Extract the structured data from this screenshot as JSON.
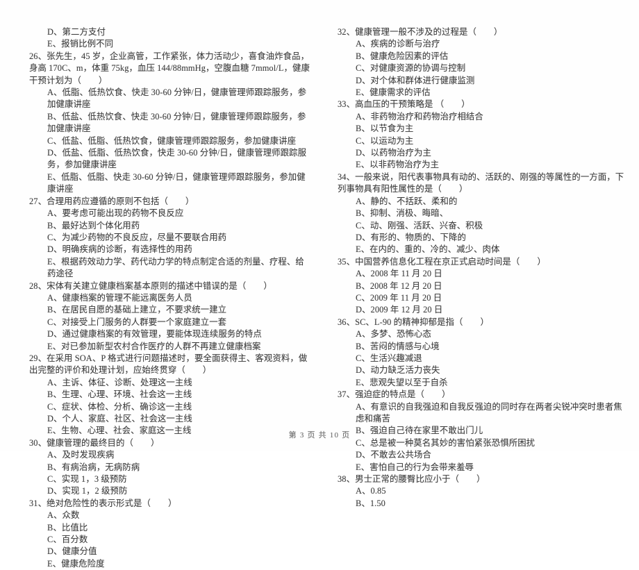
{
  "document": {
    "footer": "第 3 页 共 10 页",
    "page_number": "3",
    "total_pages": "10"
  },
  "left_column": {
    "orphan_options": [
      "D、第二方支付",
      "E、报销比例不同"
    ],
    "questions": [
      {
        "stem": "26、张先生，45 岁，企业高管，工作紧张，体力活动少，喜食油炸食品，身高 170C、m，体重 75kg，血压 144/88mmHg，空腹血糖 7mmol/L，健康干预计划为（　　）",
        "options": [
          "A、低脂、低热饮食、快走 30-60 分钟/日，健康管理师跟踪服务，参加健康讲座",
          "B、低盐、低热饮食、快走 30-60 分钟/日，健康管理师跟踪服务，参加健康讲座",
          "C、低盐、低脂、低热饮食，健康管理师跟踪服务，参加健康讲座",
          "D、低盐、低脂、低热饮食，快走 30-60 分钟/日，健康管理师跟踪服务，参加健康讲座",
          "E、低脂、低脂、快走 30-60 分钟/日，健康管理师跟踪服务，参加健康讲座"
        ]
      },
      {
        "stem": "27、合理用药应遵循的原则不包括（　　）",
        "options": [
          "A、要考虑可能出现的药物不良反应",
          "B、最好达到个体化用药",
          "C、为减少药物的不良反应，尽量不要联合用药",
          "D、明确疾病的诊断，有选择性的用药",
          "E、根据药效动力学、药代动力学的特点制定合适的剂量、疗程、给药途径"
        ]
      },
      {
        "stem": "28、宋体有关建立健康档案基本原则的描述中错误的是（　　）",
        "options": [
          "A、健康档案的管理不能远离医务人员",
          "B、在居民自愿的基础上建立，不要求统一建立",
          "C、对接受上门服务的人群要一个家庭建立一套",
          "D、通过健康档案的有效管理，要能体现连续服务的特点",
          "E、对已参加新型农村合作医疗的人群不再建立健康档案"
        ]
      },
      {
        "stem": "29、在采用 SOA、P 格式进行问题描述时，要全面获得主、客观资料，做出完整的评价和处理计划，应始终贯穿（　　）",
        "options": [
          "A、主诉、体征、诊断、处理这一主线",
          "B、生理、心理、环境、社会这一主线",
          "C、症状、体检、分析、确诊这一主线",
          "D、个人、家庭、社区、社会这一主线",
          "E、生物、心理、社会、家庭这一主线"
        ]
      },
      {
        "stem": "30、健康管理的最终目的（　　）",
        "options": [
          "A、及时发现疾病",
          "B、有病治病，无病防病",
          "C、实现 1，3 级预防",
          "D、实现 1，2 级预防"
        ]
      },
      {
        "stem": "31、绝对危险性的表示形式是（　　）",
        "options": [
          "A、众数",
          "B、比值比",
          "C、百分数",
          "D、健康分值",
          "E、健康危险度"
        ]
      }
    ]
  },
  "right_column": {
    "questions": [
      {
        "stem": "32、健康管理一般不涉及的过程是（　　）",
        "options": [
          "A、疾病的诊断与治疗",
          "B、健康危险因素的评估",
          "C、对健康资源的协调与控制",
          "D、对个体和群体进行健康监测",
          "E、健康需求的评估"
        ]
      },
      {
        "stem": "33、高血压的干预策略是 （　　）",
        "options": [
          "A、非药物治疗和药物治疗相结合",
          "B、以节食为主",
          "C、以运动为主",
          "D、以药物治疗为主",
          "E、以非药物治疗为主"
        ]
      },
      {
        "stem": "34、一般来说，阳代表事物具有动的、活跃的、刚强的等属性的一方面，下列事物具有阳性属性的是（　　）",
        "options": [
          "A、静的、不括跃、柔和的",
          "B、抑制、消极、晦暗、",
          "C、动、刚强、活跃、兴奋、积极",
          "D、有形的、物质的、下降的",
          "E、在内的、重的、冷的、减少、肉体"
        ]
      },
      {
        "stem": "35、中国营养信息化工程在京正式启动时间是（　　）",
        "options": [
          "A、2008 年 11 月 20 日",
          "B、2008 年 12 月 20 日",
          "C、2009 年 11 月 20 日",
          "D、2009 年 12 月 20 日"
        ]
      },
      {
        "stem": "36、SC、L-90 的精神抑郁是指（　　）",
        "options": [
          "A、多梦、恐怖心态",
          "B、苦闷的情感与心境",
          "C、生活兴趣减退",
          "D、动力缺乏活力丧失",
          "E、悲观失望以至于自杀"
        ]
      },
      {
        "stem": "37、强迫症的特点是（　　）",
        "options": [
          "A、有意识的自我强迫和自我反强迫的同时存在两者尖锐冲突时患者焦虑和痛苦",
          "B、强迫自己待在家里不敢出门儿",
          "C、总是被一种莫名其妙的害怕紧张恐惧所困扰",
          "D、不敢去公共场合",
          "E、害怕自己的行为会带来羞辱"
        ]
      },
      {
        "stem": "38、男士正常的腰臀比应小于（　　）",
        "options": [
          "A、0.85",
          "B、1.50"
        ]
      }
    ]
  }
}
